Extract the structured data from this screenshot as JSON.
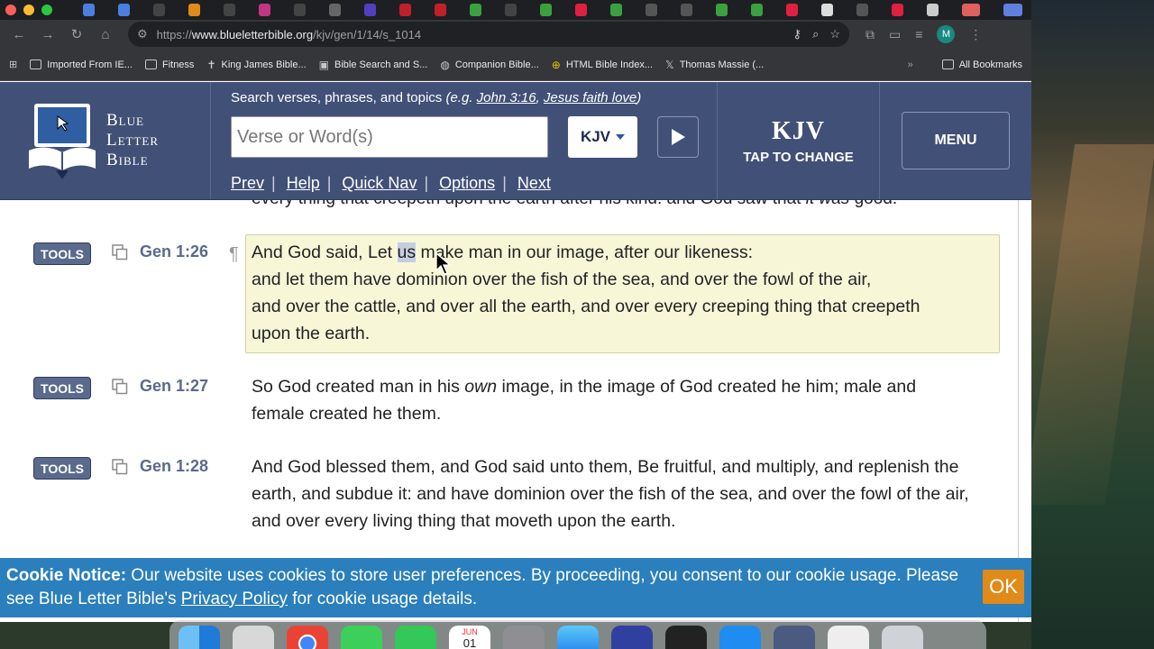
{
  "browser": {
    "url_prefix": "https://",
    "url_host": "www.blueletterbible.org",
    "url_path": "/kjv/gen/1/14/s_1014",
    "profile_initial": "M",
    "bookmarks": [
      {
        "label": "Imported From IE...",
        "icon": "folder-icon"
      },
      {
        "label": "Fitness",
        "icon": "folder-icon"
      },
      {
        "label": "King James Bible...",
        "icon": "cross-icon"
      },
      {
        "label": "Bible Search and S...",
        "icon": "bible-icon"
      },
      {
        "label": "Companion Bible...",
        "icon": "globe-icon"
      },
      {
        "label": "HTML Bible Index...",
        "icon": "cross-circle-icon"
      },
      {
        "label": "Thomas Massie (...",
        "icon": "x-icon"
      }
    ],
    "all_bookmarks": "All Bookmarks",
    "more_chevron": "»"
  },
  "header": {
    "logo_line1": "Blue",
    "logo_line2": "Letter",
    "logo_line3": "Bible",
    "search_hint_prefix": "Search verses, phrases, and topics ",
    "search_hint_eg_open": "(e.g. ",
    "search_hint_ex1": "John 3:16",
    "search_hint_comma": ", ",
    "search_hint_ex2": "Jesus faith love",
    "search_hint_eg_close": ")",
    "search_placeholder": "Verse or Word(s)",
    "version": "KJV",
    "nav": {
      "prev": "Prev",
      "help": "Help",
      "quicknav": "Quick Nav",
      "options": "Options",
      "next": "Next"
    },
    "sep": "|",
    "kjv_title": "KJV",
    "kjv_sub": "TAP TO CHANGE",
    "menu": "MENU"
  },
  "content": {
    "prev_line_a": "every thing that creepeth upon the earth after his kind: and God saw that ",
    "prev_line_i": "it was",
    "prev_line_b": " good.",
    "tools_label": "TOOLS",
    "pilcrow": "¶",
    "verses": [
      {
        "ref": "Gen 1:26",
        "l1_a": "And God said, Let ",
        "l1_sel": "us",
        "l1_b": " make man in our image, after our likeness:",
        "l2": "and let them have dominion over the fish of the sea, and over the fowl of the air,",
        "l3": "and over the cattle, and over all the earth, and over every creeping thing that creepeth",
        "l4": "upon the earth."
      },
      {
        "ref": "Gen 1:27",
        "t_a": "So God created man in his ",
        "t_i": "own",
        "t_b": " image, in the image of God created he him; male and female created he them."
      },
      {
        "ref": "Gen 1:28",
        "t": "And God blessed them, and God said unto them, Be fruitful, and multiply, and replenish the earth, and subdue it: and have dominion over the fish of the sea, and over the fowl of the air, and over every living thing that moveth upon the earth."
      }
    ]
  },
  "cookie": {
    "title": "Cookie Notice:",
    "text_a": " Our website uses cookies to store user preferences. By proceeding, you consent to our cookie usage. Please see Blue Letter Bible's ",
    "link": "Privacy Policy",
    "text_b": " for cookie usage details.",
    "ok": "OK"
  },
  "dock": {
    "calendar_month": "JUN",
    "calendar_day": "01"
  },
  "colors": {
    "header_bg": "#415076",
    "tools_bg": "#5a6a8c",
    "highlight_bg": "#f7f7d8",
    "cookie_bg": "#2a7fbc",
    "ok_bg": "#e08a1a"
  }
}
